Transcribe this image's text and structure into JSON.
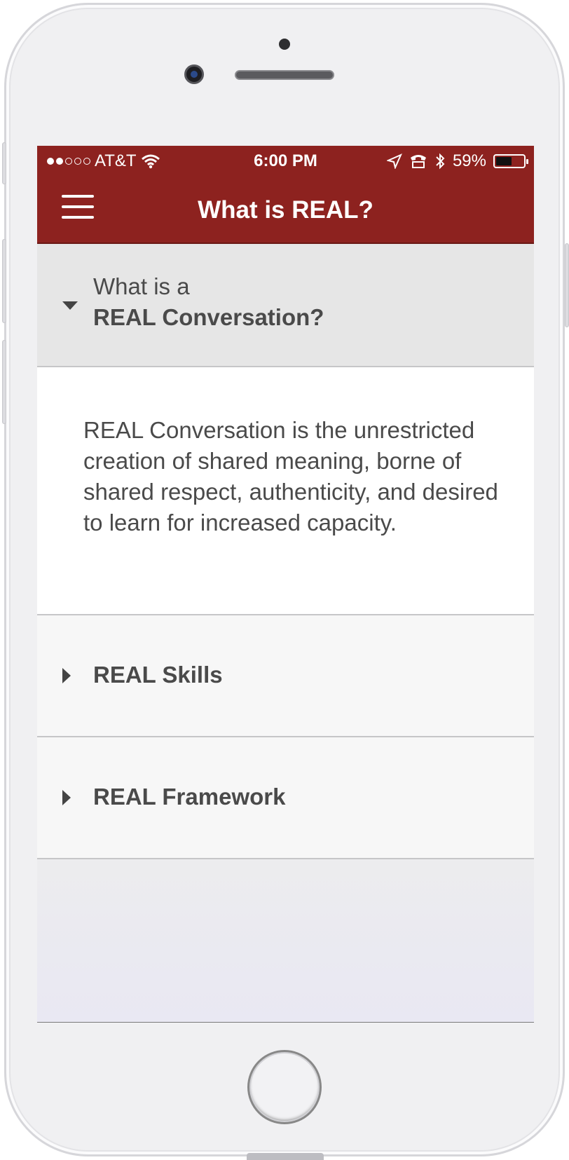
{
  "status_bar": {
    "carrier": "AT&T",
    "time": "6:00 PM",
    "battery_percent": "59%",
    "battery_level": 0.59,
    "signal_bars_filled": 2,
    "signal_bars_total": 5
  },
  "nav": {
    "title": "What is REAL?",
    "menu_icon": "hamburger-menu-icon"
  },
  "sections": {
    "conversation": {
      "subtitle": "What is a",
      "title": "REAL Conversation?",
      "expanded": true,
      "body": "REAL Conversation is the unrestricted creation of shared meaning, borne of shared respect, authenticity, and desired to learn for increased capacity."
    },
    "skills": {
      "title": "REAL Skills",
      "expanded": false
    },
    "framework": {
      "title": "REAL Framework",
      "expanded": false
    }
  },
  "colors": {
    "brand": "#8d221f",
    "text": "#4a4a4a",
    "section_header_bg": "#e6e6e6",
    "collapsed_bg": "#f7f7f7"
  }
}
